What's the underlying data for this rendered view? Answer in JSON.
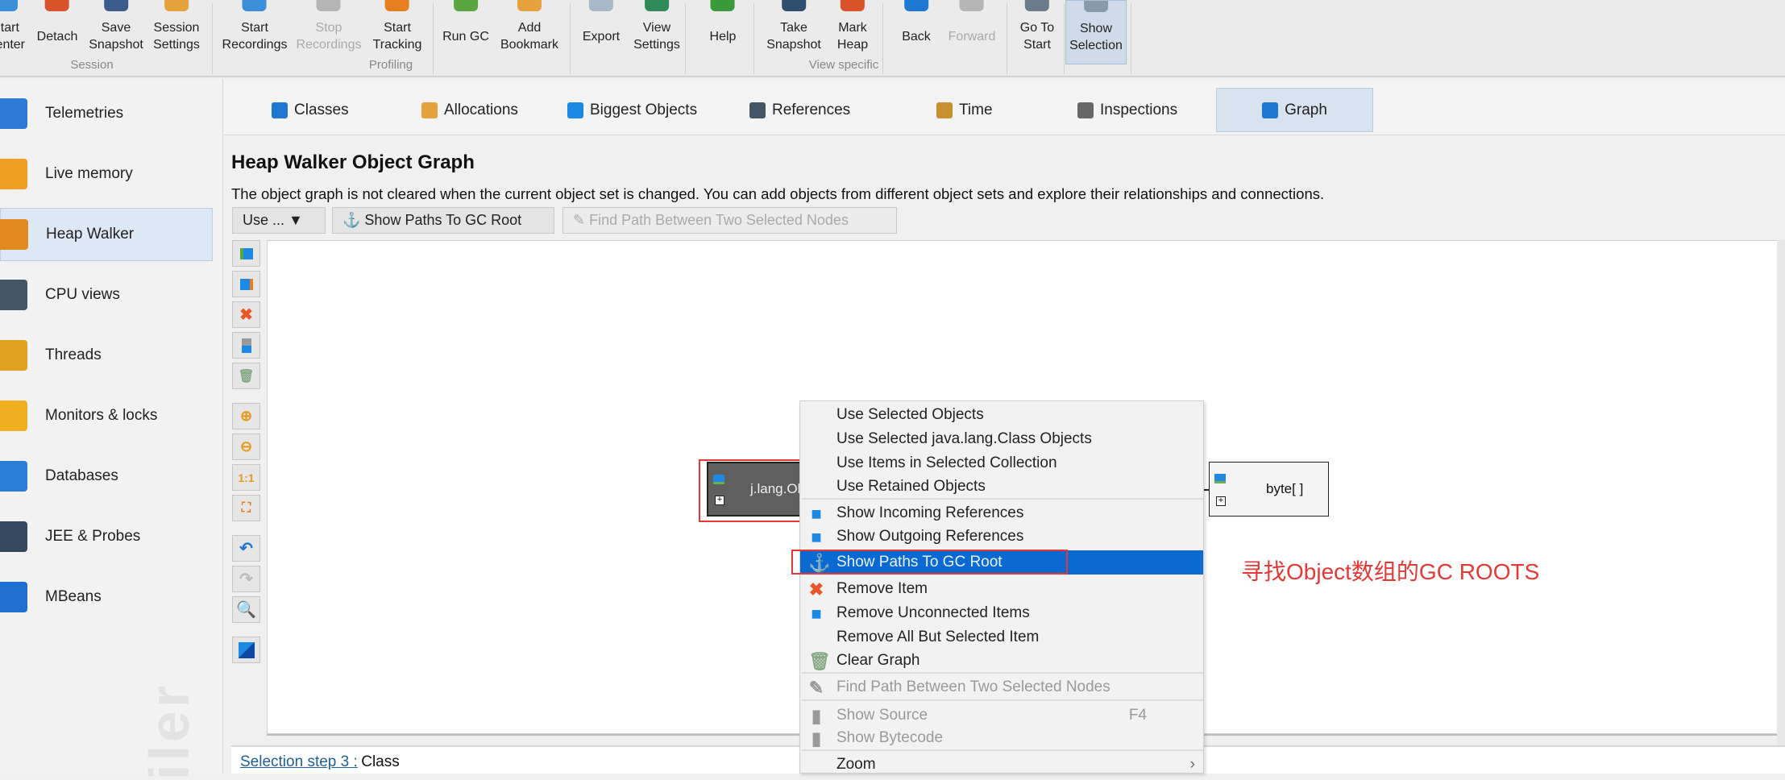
{
  "toolbar": {
    "buttons": [
      {
        "label": [
          "Start",
          "Center"
        ],
        "icon": "start-center-icon",
        "color": "#3a8fd8",
        "enabled": true
      },
      {
        "label": [
          "Detach"
        ],
        "icon": "detach-icon",
        "color": "#d9542b",
        "enabled": true
      },
      {
        "label": [
          "Save",
          "Snapshot"
        ],
        "icon": "save-snapshot-icon",
        "color": "#3b5b8c",
        "enabled": true
      },
      {
        "label": [
          "Session",
          "Settings"
        ],
        "icon": "session-settings-icon",
        "color": "#e6a23c",
        "enabled": true
      },
      {
        "label": [
          "Start",
          "Recordings"
        ],
        "icon": "start-recordings-icon",
        "color": "#3a8fd8",
        "enabled": true
      },
      {
        "label": [
          "Stop",
          "Recordings"
        ],
        "icon": "stop-recordings-icon",
        "color": "#b5b5b5",
        "enabled": false
      },
      {
        "label": [
          "Start",
          "Tracking"
        ],
        "icon": "start-tracking-icon",
        "color": "#e67e22",
        "enabled": true
      },
      {
        "label": [
          "Run GC"
        ],
        "icon": "run-gc-icon",
        "color": "#5aa640",
        "enabled": true
      },
      {
        "label": [
          "Add",
          "Bookmark"
        ],
        "icon": "add-bookmark-icon",
        "color": "#e6a23c",
        "enabled": true
      },
      {
        "label": [
          "Export"
        ],
        "icon": "export-icon",
        "color": "#a8b8c8",
        "enabled": true
      },
      {
        "label": [
          "View",
          "Settings"
        ],
        "icon": "view-settings-icon",
        "color": "#2e8b57",
        "enabled": true
      },
      {
        "label": [
          "Help"
        ],
        "icon": "help-icon",
        "color": "#3a9a3a",
        "enabled": true
      },
      {
        "label": [
          "Take",
          "Snapshot"
        ],
        "icon": "take-snapshot-icon",
        "color": "#2f4f6f",
        "enabled": true
      },
      {
        "label": [
          "Mark",
          "Heap"
        ],
        "icon": "mark-heap-icon",
        "color": "#d9542b",
        "enabled": true
      },
      {
        "label": [
          "Back"
        ],
        "icon": "back-icon",
        "color": "#1e78d2",
        "enabled": true
      },
      {
        "label": [
          "Forward"
        ],
        "icon": "forward-icon",
        "color": "#b5b5b5",
        "enabled": false
      },
      {
        "label": [
          "Go To",
          "Start"
        ],
        "icon": "go-to-start-icon",
        "color": "#6b7b8b",
        "enabled": true
      },
      {
        "label": [
          "Show",
          "Selection"
        ],
        "icon": "show-selection-icon",
        "color": "#8a9aaa",
        "enabled": true,
        "selected": true
      }
    ],
    "groups": [
      "Session",
      "Profiling",
      "View specific"
    ]
  },
  "sidebar": {
    "items": [
      {
        "label": "Telemetries",
        "icon": "telemetries-icon",
        "color": "#2e7bd6"
      },
      {
        "label": "Live memory",
        "icon": "live-memory-icon",
        "color": "#f0a020"
      },
      {
        "label": "Heap Walker",
        "icon": "heap-walker-icon",
        "color": "#e08a20",
        "selected": true
      },
      {
        "label": "CPU views",
        "icon": "cpu-views-icon",
        "color": "#445566"
      },
      {
        "label": "Threads",
        "icon": "threads-icon",
        "color": "#e0a020"
      },
      {
        "label": "Monitors & locks",
        "icon": "lock-icon",
        "color": "#f0b020"
      },
      {
        "label": "Databases",
        "icon": "databases-icon",
        "color": "#2a7fd4"
      },
      {
        "label": "JEE & Probes",
        "icon": "probes-icon",
        "color": "#34495e"
      },
      {
        "label": "MBeans",
        "icon": "mbeans-icon",
        "color": "#1e6fd0"
      }
    ],
    "watermark": "iler"
  },
  "tabs": [
    {
      "label": "Classes",
      "icon": "classes-icon",
      "color": "#1e78d2"
    },
    {
      "label": "Allocations",
      "icon": "allocations-icon",
      "color": "#e6a23c"
    },
    {
      "label": "Biggest Objects",
      "icon": "biggest-objects-icon",
      "color": "#1e88e5"
    },
    {
      "label": "References",
      "icon": "references-icon",
      "color": "#445566"
    },
    {
      "label": "Time",
      "icon": "time-icon",
      "color": "#c89030"
    },
    {
      "label": "Inspections",
      "icon": "inspections-icon",
      "color": "#666666"
    },
    {
      "label": "Graph",
      "icon": "graph-icon",
      "color": "#1e78d2",
      "selected": true
    }
  ],
  "main": {
    "title": "Heap Walker Object Graph",
    "description": "The object graph is not cleared when the current object set is changed. You can add objects from different object sets and explore their relationships and connections.",
    "use_button": "Use ... ▼",
    "show_paths_button": "⚓ Show Paths To GC Root",
    "find_path_button": "✎ Find Path Between Two Selected Nodes"
  },
  "graph": {
    "nodes": [
      {
        "label": "j.lang.Ob",
        "selected": true
      },
      {
        "label": "byte[ ]",
        "selected": false
      }
    ]
  },
  "context_menu": {
    "items": [
      {
        "label": "Use Selected Objects"
      },
      {
        "label": "Use Selected java.lang.Class Objects"
      },
      {
        "label": "Use Items in Selected Collection"
      },
      {
        "label": "Use Retained Objects"
      },
      {
        "label": "Show Incoming References",
        "icon": "incoming-references-icon"
      },
      {
        "label": "Show Outgoing References",
        "icon": "outgoing-references-icon"
      },
      {
        "label": "Show Paths To GC Root",
        "icon": "anchor-icon",
        "highlighted": true
      },
      {
        "label": "Remove Item",
        "icon": "remove-icon"
      },
      {
        "label": "Remove Unconnected Items",
        "icon": "remove-unconnected-icon"
      },
      {
        "label": "Remove All But Selected Item"
      },
      {
        "label": "Clear Graph",
        "icon": "trash-icon"
      },
      {
        "label": "Find Path Between Two Selected Nodes",
        "icon": "pencil-icon",
        "disabled": true
      },
      {
        "label": "Show Source",
        "icon": "source-icon",
        "disabled": true,
        "shortcut": "F4"
      },
      {
        "label": "Show Bytecode",
        "icon": "bytecode-icon",
        "disabled": true
      },
      {
        "label": "Zoom",
        "submenu": true
      }
    ]
  },
  "annotation": "寻找Object数组的GC ROOTS",
  "status": {
    "link": "Selection step 3 :",
    "value": "Class"
  },
  "colors": {
    "highlight": "#0a6ad2",
    "annotation": "#e53935",
    "node_selected_bg": "#5f5f5f"
  }
}
